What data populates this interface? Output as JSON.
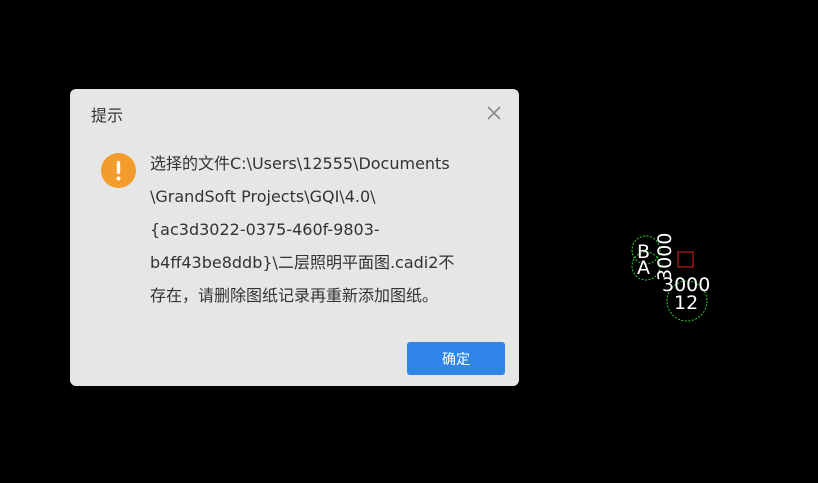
{
  "dialog": {
    "title": "提示",
    "close_icon": "close-icon",
    "warning_icon": "exclamation-icon",
    "message_lines": [
      "选择的文件C:\\Users\\12555\\Documents",
      "\\GrandSoft Projects\\GQI\\4.0\\",
      "{ac3d3022-0375-460f-9803-",
      "b4ff43be8ddb}\\二层照明平面图.cadi2不",
      "存在，请删除图纸记录再重新添加图纸。"
    ],
    "ok_label": "确定"
  },
  "cad": {
    "labels": {
      "axis_b": "B",
      "axis_a": "A",
      "dim_vertical": "3000",
      "dim_horizontal": "3000",
      "axis_12": "12"
    }
  },
  "colors": {
    "background": "#000000",
    "dialog_bg": "#e6e6e6",
    "warning": "#f39c2c",
    "primary_button": "#2f86e8",
    "cad_green": "#33cc33",
    "cad_red": "#e02020"
  }
}
